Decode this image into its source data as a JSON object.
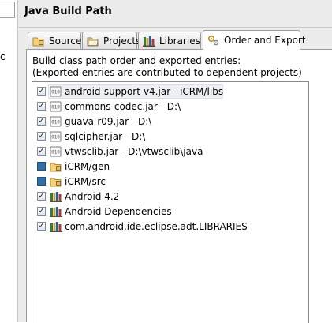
{
  "page": {
    "title": "Java Build Path",
    "left_cut_text": "c"
  },
  "tabs": [
    {
      "label": "Source",
      "icon": "source-folder-icon",
      "active": false
    },
    {
      "label": "Projects",
      "icon": "projects-icon",
      "active": false
    },
    {
      "label": "Libraries",
      "icon": "libraries-icon",
      "active": false
    },
    {
      "label": "Order and Export",
      "icon": "order-export-icon",
      "active": true
    }
  ],
  "description": {
    "line1": "Build class path order and exported entries:",
    "line2": "(Exported entries are contributed to dependent projects)"
  },
  "entries": [
    {
      "label": "android-support-v4.jar - iCRM/libs",
      "checked": true,
      "icon": "jar-icon",
      "selected": true
    },
    {
      "label": "commons-codec.jar - D:\\",
      "checked": true,
      "icon": "jar-icon",
      "selected": false
    },
    {
      "label": "guava-r09.jar - D:\\",
      "checked": true,
      "icon": "jar-icon",
      "selected": false
    },
    {
      "label": "sqlcipher.jar - D:\\",
      "checked": true,
      "icon": "jar-icon",
      "selected": false
    },
    {
      "label": "vtwsclib.jar - D:\\vtwsclib\\java",
      "checked": true,
      "icon": "jar-icon",
      "selected": false
    },
    {
      "label": "iCRM/gen",
      "checked": false,
      "icon": "source-folder-icon",
      "selected": false
    },
    {
      "label": "iCRM/src",
      "checked": false,
      "icon": "source-folder-icon",
      "selected": false
    },
    {
      "label": "Android 4.2",
      "checked": true,
      "icon": "library-icon",
      "selected": false
    },
    {
      "label": "Android Dependencies",
      "checked": true,
      "icon": "library-icon",
      "selected": false
    },
    {
      "label": "com.android.ide.eclipse.adt.LIBRARIES",
      "checked": true,
      "icon": "library-icon",
      "selected": false
    }
  ],
  "check_mark": "✓"
}
